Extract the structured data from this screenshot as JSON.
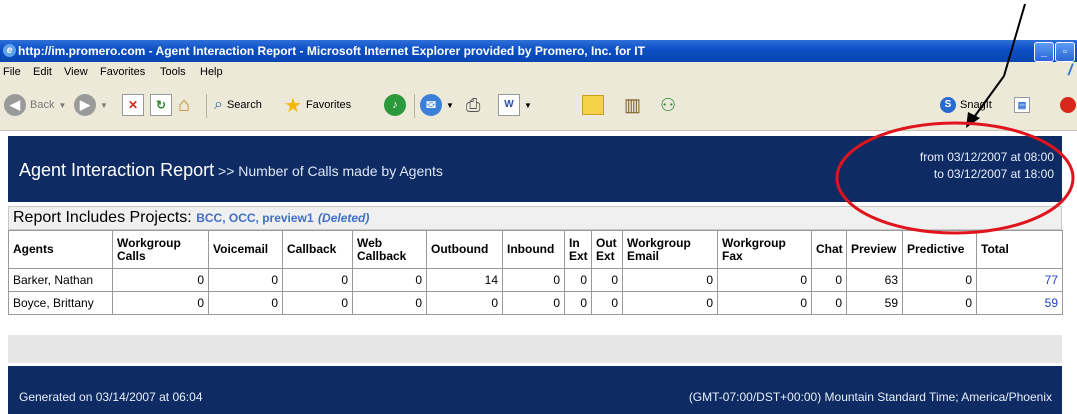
{
  "window": {
    "title": "http://im.promero.com - Agent Interaction Report - Microsoft Internet Explorer provided by Promero, Inc. for IT"
  },
  "menu": [
    "File",
    "Edit",
    "View",
    "Favorites",
    "Tools",
    "Help"
  ],
  "toolbar": {
    "back_label": "Back",
    "search_label": "Search",
    "favorites_label": "Favorites",
    "snagit_label": "SnagIt"
  },
  "report": {
    "title": "Agent Interaction Report",
    "subtitle": " >> Number of Calls made by Agents",
    "from": "from 03/12/2007 at 08:00",
    "to": "to 03/12/2007 at 18:00",
    "projects_label": "Report Includes Projects: ",
    "projects": "BCC, OCC, preview1",
    "projects_deleted": "(Deleted)"
  },
  "table": {
    "headers": [
      "Agents",
      "Workgroup Calls",
      "Voicemail",
      "Callback",
      "Web Callback",
      "Outbound",
      "Inbound",
      "In Ext",
      "Out Ext",
      "Workgroup Email",
      "Workgroup Fax",
      "Chat",
      "Preview",
      "Predictive",
      "Total"
    ],
    "rows": [
      [
        "Barker, Nathan",
        "0",
        "0",
        "0",
        "0",
        "14",
        "0",
        "0",
        "0",
        "0",
        "0",
        "0",
        "63",
        "0",
        "77"
      ],
      [
        "Boyce, Brittany",
        "0",
        "0",
        "0",
        "0",
        "0",
        "0",
        "0",
        "0",
        "0",
        "0",
        "0",
        "59",
        "0",
        "59"
      ]
    ]
  },
  "footer": {
    "generated": "Generated on 03/14/2007 at 06:04",
    "timezone": "(GMT-07:00/DST+00:00) Mountain Standard Time; America/Phoenix"
  },
  "colors": {
    "header_bg": "#0e2c63",
    "link": "#1f3fc7",
    "annotation": "#e0141c"
  }
}
